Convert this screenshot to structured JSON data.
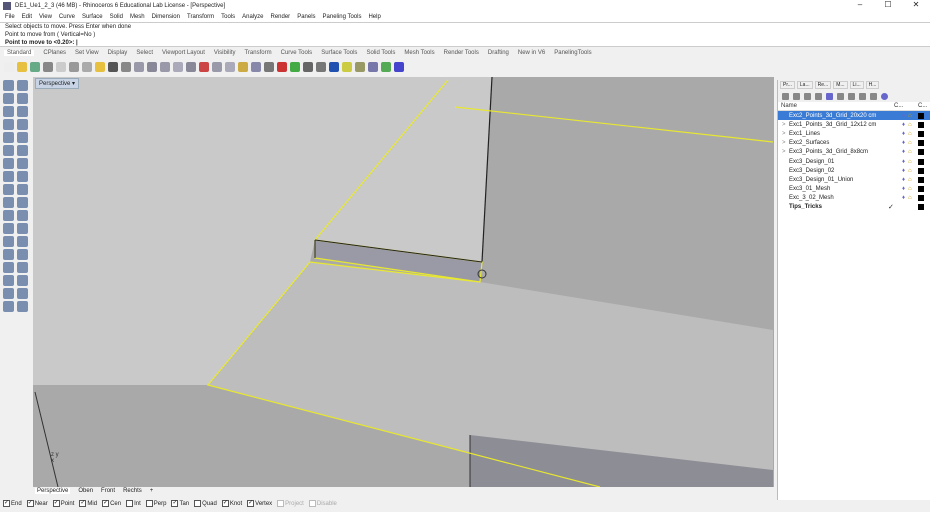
{
  "title": "DE1_Ue1_2_3 (46 MB) - Rhinoceros 6 Educational Lab License - [Perspective]",
  "window_controls": [
    "–",
    "☐",
    "✕"
  ],
  "menu": [
    "File",
    "Edit",
    "View",
    "Curve",
    "Surface",
    "Solid",
    "Mesh",
    "Dimension",
    "Transform",
    "Tools",
    "Analyze",
    "Render",
    "Panels",
    "Paneling Tools",
    "Help"
  ],
  "command_history": [
    "Select objects to move. Press Enter when done",
    "Point to move from ( Vertical=No )"
  ],
  "command_prompt": "Point to move to <0.20>:",
  "toolbar_tabs": [
    "Standard",
    "CPlanes",
    "Set View",
    "Display",
    "Select",
    "Viewport Layout",
    "Visibility",
    "Transform",
    "Curve Tools",
    "Surface Tools",
    "Solid Tools",
    "Mesh Tools",
    "Render Tools",
    "Drafting",
    "New in V6",
    "PanelingTools"
  ],
  "toolbar_icon_colors": [
    "#eee",
    "#e8c040",
    "#6a8",
    "#888",
    "#ccc",
    "#999",
    "#aaa",
    "#e8c040",
    "#555",
    "#888",
    "#99a",
    "#889",
    "#99a",
    "#aab",
    "#889",
    "#c44",
    "#99a",
    "#aab",
    "#ccaa44",
    "#88a",
    "#777",
    "#c33",
    "#4a4",
    "#666",
    "#777",
    "#2050b0",
    "#cc4",
    "#996",
    "#77a",
    "#5a5",
    "#44c"
  ],
  "viewport": {
    "label": "Perspective ▾",
    "axis_labels": [
      "z",
      "x",
      "y"
    ]
  },
  "viewport_tabs": [
    "Perspective",
    "Oben",
    "Front",
    "Rechts",
    "+"
  ],
  "osnaps": [
    {
      "label": "End",
      "on": true
    },
    {
      "label": "Near",
      "on": true
    },
    {
      "label": "Point",
      "on": true
    },
    {
      "label": "Mid",
      "on": true
    },
    {
      "label": "Cen",
      "on": true
    },
    {
      "label": "Int",
      "on": false
    },
    {
      "label": "Perp",
      "on": false
    },
    {
      "label": "Tan",
      "on": true
    },
    {
      "label": "Quad",
      "on": false
    },
    {
      "label": "Knot",
      "on": true
    },
    {
      "label": "Vertex",
      "on": true
    },
    {
      "label": "Project",
      "on": false,
      "disabled": true
    },
    {
      "label": "Disable",
      "on": false,
      "disabled": true
    }
  ],
  "panel": {
    "tabs": [
      "Pr...",
      "La...",
      "Re...",
      "M...",
      "Li...",
      "H..."
    ],
    "columns": {
      "name": "Name",
      "current": "C...",
      "color": "C..."
    },
    "layers": [
      {
        "name": "Exc2_Points_3d_Grid_20x20 cm",
        "expand": "",
        "selected": true,
        "check": ""
      },
      {
        "name": "Exc1_Points_3d_Grid_12x12 cm",
        "expand": ">",
        "check": ""
      },
      {
        "name": "Exc1_Lines",
        "expand": ">",
        "check": ""
      },
      {
        "name": "Exc2_Surfaces",
        "expand": ">",
        "check": ""
      },
      {
        "name": "Exc3_Points_3d_Grid_8x8cm",
        "expand": ">",
        "check": ""
      },
      {
        "name": "Exc3_Design_01",
        "expand": "",
        "check": ""
      },
      {
        "name": "Exc3_Design_02",
        "expand": "",
        "check": ""
      },
      {
        "name": "Exc3_Design_01_Union",
        "expand": "",
        "check": ""
      },
      {
        "name": "Exc3_01_Mesh",
        "expand": "",
        "check": ""
      },
      {
        "name": "Exc_3_02_Mesh",
        "expand": "",
        "check": ""
      },
      {
        "name": "Tips_Tricks",
        "expand": "",
        "bold": true,
        "check": "✓"
      }
    ]
  },
  "colors": {
    "selection": "#e8e830",
    "accent": "#3a7bd5"
  }
}
